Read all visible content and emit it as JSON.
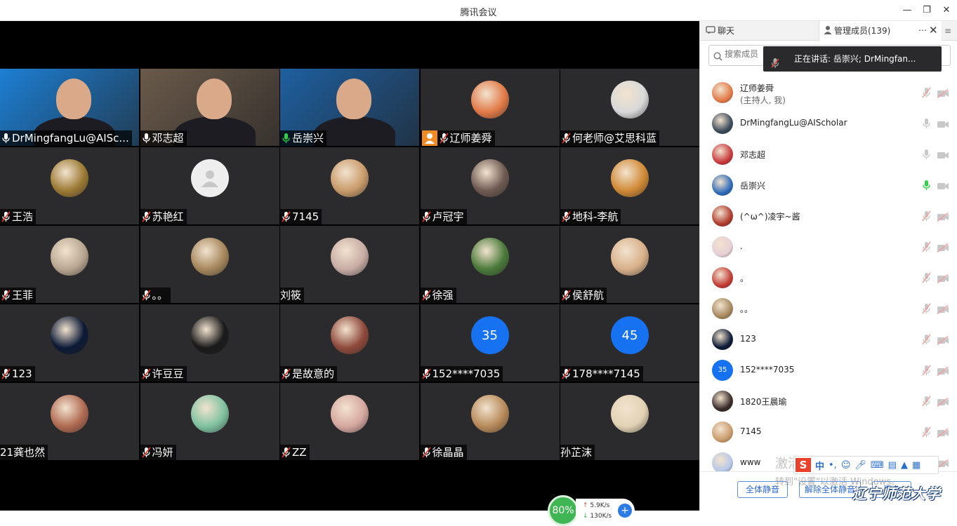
{
  "window": {
    "title": "腾讯会议"
  },
  "video": {
    "tiles": [
      {
        "name": "DrMingfangLu@AISc...",
        "kind": "camera",
        "bg": "#1d7fd4",
        "mic": "on"
      },
      {
        "name": "邓志超",
        "kind": "camera",
        "bg": "#6a5a4a",
        "mic": "on"
      },
      {
        "name": "岳崇兴",
        "kind": "camera",
        "bg": "#1e5fa0",
        "mic": "active",
        "speaking": true
      },
      {
        "name": "辽师姜舜",
        "kind": "avatar",
        "bg": "#e27a48",
        "mic": "muted",
        "host": true
      },
      {
        "name": "何老师@艾思科蓝",
        "kind": "avatar",
        "bg": "#d9d9d9",
        "mic": "muted"
      },
      {
        "name": "王浩",
        "kind": "avatar",
        "bg": "#9c7a34",
        "mic": "muted"
      },
      {
        "name": "苏艳红",
        "kind": "avatar",
        "bg": "#eeeeee",
        "mic": "muted",
        "placeholder": true
      },
      {
        "name": "7145",
        "kind": "avatar",
        "bg": "#c99b6a",
        "mic": "muted"
      },
      {
        "name": "卢冠宇",
        "kind": "avatar",
        "bg": "#6f5a52",
        "mic": "muted"
      },
      {
        "name": "地科-李航",
        "kind": "avatar",
        "bg": "#d08a36",
        "mic": "muted"
      },
      {
        "name": "王菲",
        "kind": "avatar",
        "bg": "#b8a690",
        "mic": "muted"
      },
      {
        "name": "。。",
        "kind": "avatar",
        "bg": "#a6875c",
        "mic": "muted"
      },
      {
        "name": "刘筱",
        "kind": "avatar",
        "bg": "#c7aca4",
        "mic": "none"
      },
      {
        "name": "徐强",
        "kind": "avatar",
        "bg": "#4b7a3a",
        "mic": "muted"
      },
      {
        "name": "侯舒航",
        "kind": "avatar",
        "bg": "#d8b08a",
        "mic": "muted"
      },
      {
        "name": "123",
        "kind": "avatar",
        "bg": "#0c1a36",
        "mic": "muted"
      },
      {
        "name": "许豆豆",
        "kind": "avatar",
        "bg": "#1a1a1a",
        "mic": "muted"
      },
      {
        "name": "是故意的",
        "kind": "avatar",
        "bg": "#8f4a3c",
        "mic": "muted"
      },
      {
        "name": "152****7035",
        "kind": "number",
        "bg": "#1672f0",
        "num": "35",
        "mic": "muted"
      },
      {
        "name": "178****7145",
        "kind": "number",
        "bg": "#1672f0",
        "num": "45",
        "mic": "muted"
      },
      {
        "name": "21龚也然",
        "kind": "avatar",
        "bg": "#b06a52",
        "mic": "none"
      },
      {
        "name": "冯妍",
        "kind": "avatar",
        "bg": "#7fc2a0",
        "mic": "muted"
      },
      {
        "name": "ZZ",
        "kind": "avatar",
        "bg": "#d6a8a0",
        "mic": "muted"
      },
      {
        "name": "徐晶晶",
        "kind": "avatar",
        "bg": "#b88a5a",
        "mic": "muted"
      },
      {
        "name": "孙芷沫",
        "kind": "avatar",
        "bg": "#e2d2b4",
        "mic": "none"
      }
    ]
  },
  "network": {
    "cpu": "80%",
    "up": "5.9K/s",
    "down": "130K/s"
  },
  "panel": {
    "tab_chat": "聊天",
    "tab_members": "管理成员(139)",
    "search_placeholder": "搜索成员",
    "speaking_text": "正在讲话: 岳崇兴; DrMingfan...",
    "members": [
      {
        "name": "辽师姜舜",
        "sub": "(主持人, 我)",
        "bg": "#e27a48",
        "mic": "muted",
        "cam": "off"
      },
      {
        "name": "DrMingfangLu@AIScholar",
        "bg": "#3a4a5a",
        "mic": "on",
        "cam": "on"
      },
      {
        "name": "邓志超",
        "bg": "#c8383c",
        "mic": "on",
        "cam": "on"
      },
      {
        "name": "岳崇兴",
        "bg": "#2d6ab8",
        "mic": "active",
        "cam": "on"
      },
      {
        "name": "(^ω^)凌宇~酱",
        "bg": "#b03a2e",
        "mic": "muted",
        "cam": "off"
      },
      {
        "name": ".",
        "bg": "#e6d0d6",
        "mic": "muted",
        "cam": "off"
      },
      {
        "name": "。",
        "bg": "#c23a34",
        "mic": "muted",
        "cam": "off"
      },
      {
        "name": "。。",
        "bg": "#a6875c",
        "mic": "muted",
        "cam": "off"
      },
      {
        "name": "123",
        "bg": "#0c1a36",
        "mic": "muted",
        "cam": "off"
      },
      {
        "name": "152****7035",
        "bg": "#1672f0",
        "num": "35",
        "mic": "muted",
        "cam": "off"
      },
      {
        "name": "1820王晨瑜",
        "bg": "#3a2a28",
        "mic": "muted",
        "cam": "off"
      },
      {
        "name": "7145",
        "bg": "#c99b6a",
        "mic": "muted",
        "cam": "off"
      },
      {
        "name": "www",
        "bg": "#b6c8e8",
        "mic": "muted",
        "cam": "off"
      }
    ],
    "mute_all": "全体静音",
    "unmute_all": "解除全体静音",
    "more": "更多"
  },
  "overlay": {
    "activate_line1": "激活 Windows",
    "activate_line2": "转到\"设置\"以激活 Windows。",
    "ime_lang": "中",
    "ime_logo": "S",
    "logo_text": "辽宁师范大学"
  }
}
